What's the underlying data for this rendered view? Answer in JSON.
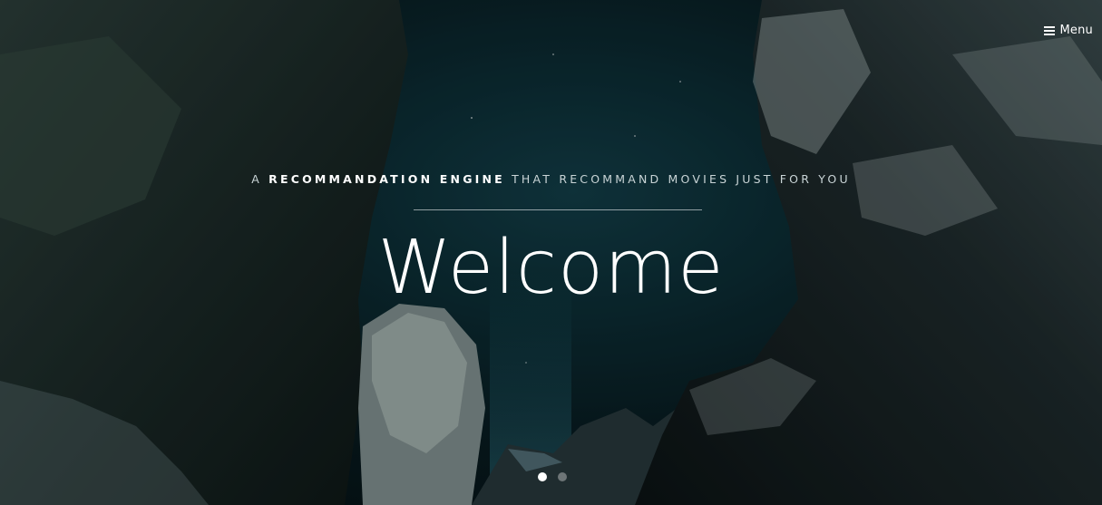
{
  "header": {
    "menu_label": "Menu",
    "menu_icon": "hamburger-icon"
  },
  "hero": {
    "tagline_prefix": "A ",
    "tagline_bold": "RECOMMANDATION ENGINE",
    "tagline_rest": " THAT RECOMMAND MOVIES JUST FOR YOU",
    "title": "Welcome",
    "slide_count": 2,
    "active_slide": 1
  },
  "colors": {
    "background": "#0b2a31",
    "text": "#ffffff",
    "tagline_text": "#c9d4d6"
  }
}
